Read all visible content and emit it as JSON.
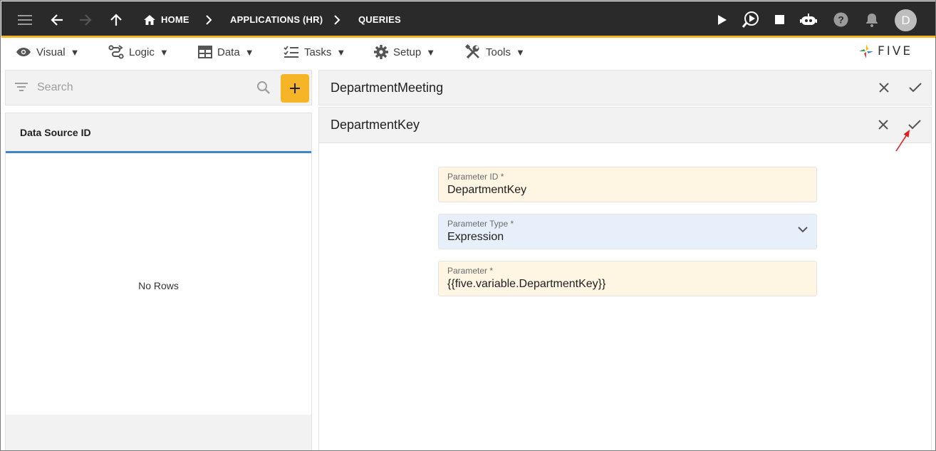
{
  "topbar": {
    "breadcrumbs": [
      "HOME",
      "APPLICATIONS (HR)",
      "QUERIES"
    ],
    "avatar_letter": "D",
    "accent_color": "#f6b527",
    "icons": [
      "menu-icon",
      "back-arrow-icon",
      "forward-arrow-icon",
      "up-arrow-icon",
      "home-icon",
      "play-icon",
      "debug-play-icon",
      "stop-icon",
      "chatbot-icon",
      "help-icon",
      "bell-icon"
    ]
  },
  "menubar": {
    "items": [
      {
        "label": "Visual",
        "icon": "eye-icon"
      },
      {
        "label": "Logic",
        "icon": "logic-icon"
      },
      {
        "label": "Data",
        "icon": "table-icon"
      },
      {
        "label": "Tasks",
        "icon": "checklist-icon"
      },
      {
        "label": "Setup",
        "icon": "gear-icon"
      },
      {
        "label": "Tools",
        "icon": "tools-icon"
      }
    ],
    "caret": "▼",
    "logo_text": "FIVE"
  },
  "left": {
    "search_placeholder": "Search",
    "column_header": "Data Source ID",
    "empty_text": "No Rows"
  },
  "right": {
    "parent_title": "DepartmentMeeting",
    "form_title": "DepartmentKey",
    "fields": [
      {
        "label": "Parameter ID *",
        "value": "DepartmentKey"
      },
      {
        "label": "Parameter Type *",
        "value": "Expression"
      },
      {
        "label": "Parameter *",
        "value": "{{five.variable.DepartmentKey}}"
      }
    ]
  }
}
